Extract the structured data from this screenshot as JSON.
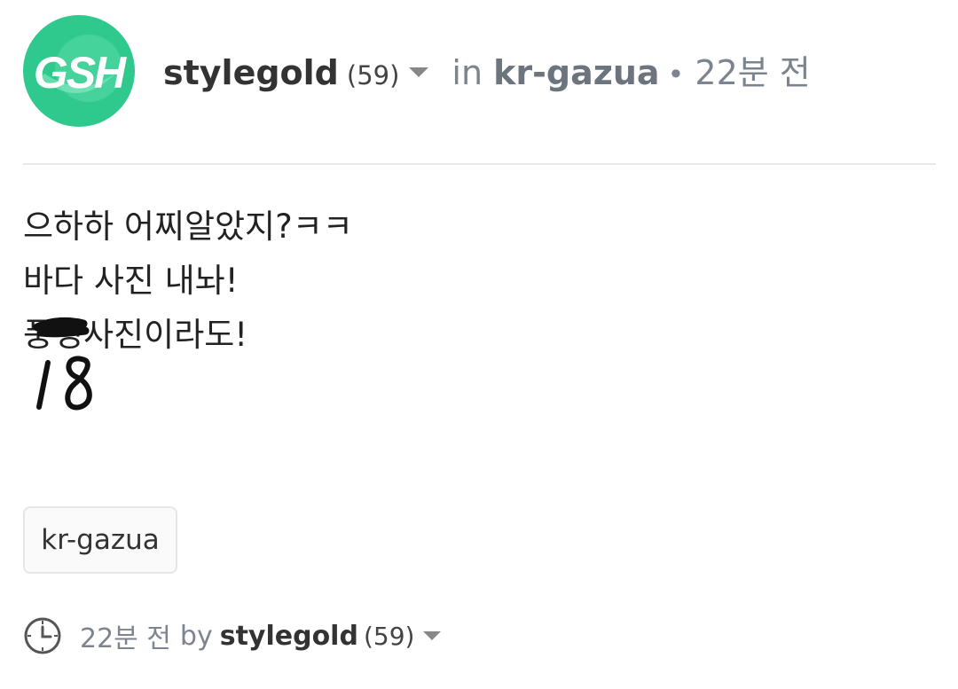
{
  "post_header": {
    "avatar": {
      "logo_text": "GSH",
      "icon": "user-avatar",
      "color": "#2fc98d"
    },
    "author": "stylegold",
    "reputation": "(59)",
    "in_label": "in",
    "community": "kr-gazua",
    "separator": "•",
    "time_ago": "22분 전"
  },
  "post_body": {
    "lines": [
      "으하하 어찌알았지?ㅋㅋ",
      "바다 사진 내놔!",
      "풍경사진이라도!"
    ],
    "handwritten_note": "18"
  },
  "tags": [
    "kr-gazua"
  ],
  "footer": {
    "clock_icon": "clock-icon",
    "time_ago": "22분 전",
    "by_label": "by",
    "author": "stylegold",
    "reputation": "(59)"
  },
  "colors": {
    "accent_green": "#2fc98d",
    "muted_text": "#7c858f",
    "divider": "#e8e8e8"
  }
}
